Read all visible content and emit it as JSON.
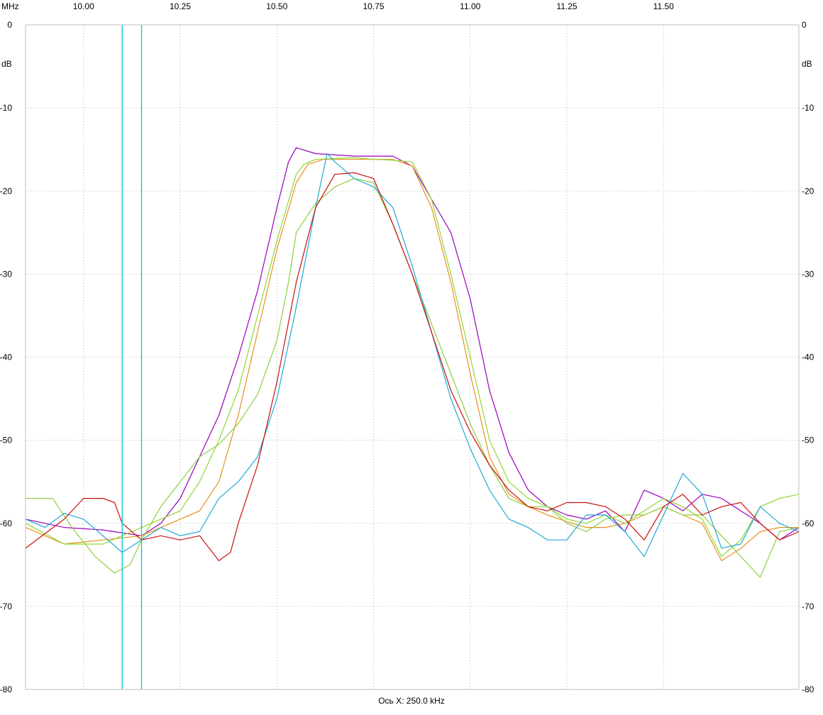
{
  "chart_data": {
    "type": "line",
    "x_unit_label": "MHz",
    "y_unit_label": "dB",
    "footer_label": "Ось X: 250.0 kHz",
    "xlim": [
      9.85,
      11.85
    ],
    "ylim": [
      -80,
      0
    ],
    "x_ticks": [
      10.0,
      10.25,
      10.5,
      10.75,
      11.0,
      11.25,
      11.5
    ],
    "x_tick_labels": [
      "10.00",
      "10.25",
      "10.50",
      "10.75",
      "11.00",
      "11.25",
      "11.50"
    ],
    "y_ticks": [
      0,
      -10,
      -20,
      -30,
      -40,
      -50,
      -60,
      -70,
      -80
    ],
    "y_tick_labels": [
      "0",
      "-10",
      "-20",
      "-30",
      "-40",
      "-50",
      "-60",
      "-70",
      "-80"
    ],
    "grid": true,
    "markers": [
      10.1,
      10.15
    ],
    "colors": {
      "marker": "#00c8c8",
      "grid": "#b4b4b4"
    },
    "series": [
      {
        "color": "#9900bb",
        "x": [
          9.85,
          9.95,
          10.05,
          10.15,
          10.2,
          10.25,
          10.3,
          10.35,
          10.4,
          10.45,
          10.5,
          10.53,
          10.55,
          10.6,
          10.7,
          10.8,
          10.85,
          10.9,
          10.95,
          11.0,
          11.05,
          11.1,
          11.15,
          11.2,
          11.25,
          11.3,
          11.35,
          11.4,
          11.45,
          11.5,
          11.55,
          11.6,
          11.65,
          11.7,
          11.75,
          11.8,
          11.85
        ],
        "y": [
          -59.5,
          -60.5,
          -60.8,
          -61.5,
          -60,
          -57,
          -52,
          -47,
          -40,
          -32,
          -22,
          -16.5,
          -14.8,
          -15.5,
          -15.8,
          -15.8,
          -17,
          -21,
          -25,
          -33,
          -44,
          -51.5,
          -56,
          -58,
          -59,
          -59.5,
          -58.5,
          -61,
          -56,
          -57,
          -58.5,
          -56.5,
          -57,
          -58.5,
          -60,
          -62,
          -60.5
        ]
      },
      {
        "color": "#e89020",
        "x": [
          9.85,
          9.95,
          10.05,
          10.15,
          10.25,
          10.3,
          10.35,
          10.4,
          10.45,
          10.5,
          10.55,
          10.58,
          10.62,
          10.7,
          10.8,
          10.85,
          10.9,
          10.95,
          11.0,
          11.05,
          11.1,
          11.15,
          11.2,
          11.25,
          11.3,
          11.35,
          11.4,
          11.45,
          11.5,
          11.55,
          11.6,
          11.65,
          11.7,
          11.75,
          11.8,
          11.85
        ],
        "y": [
          -60.5,
          -62.5,
          -62,
          -61.5,
          -59.5,
          -58.5,
          -55,
          -47,
          -37,
          -27,
          -19,
          -16.8,
          -16.2,
          -16.2,
          -16.2,
          -17,
          -22,
          -31,
          -42,
          -52,
          -56.5,
          -58,
          -59,
          -59.8,
          -60.5,
          -60.5,
          -60,
          -59,
          -58,
          -59,
          -60,
          -64.5,
          -63,
          -61,
          -60.5,
          -60.5
        ]
      },
      {
        "color": "#90d830",
        "x": [
          9.85,
          9.95,
          10.05,
          10.15,
          10.25,
          10.3,
          10.35,
          10.4,
          10.45,
          10.5,
          10.55,
          10.57,
          10.6,
          10.7,
          10.75,
          10.8,
          10.85,
          10.9,
          10.95,
          11.0,
          11.05,
          11.1,
          11.15,
          11.2,
          11.25,
          11.3,
          11.35,
          11.4,
          11.45,
          11.5,
          11.55,
          11.6,
          11.65,
          11.7,
          11.75,
          11.8,
          11.85
        ],
        "y": [
          -60,
          -62.5,
          -62.5,
          -60.5,
          -58.5,
          -55,
          -50,
          -44,
          -35,
          -26,
          -18,
          -16.8,
          -16.2,
          -16,
          -16.2,
          -16.3,
          -16.5,
          -21,
          -30,
          -40,
          -50,
          -55,
          -57,
          -58,
          -59.5,
          -60,
          -59,
          -60,
          -58.5,
          -57,
          -58,
          -59.5,
          -64,
          -62,
          -58,
          -57,
          -56.5
        ]
      },
      {
        "color": "#8cd03c",
        "x": [
          9.85,
          9.92,
          9.97,
          10.03,
          10.08,
          10.12,
          10.15,
          10.2,
          10.25,
          10.3,
          10.35,
          10.4,
          10.45,
          10.5,
          10.53,
          10.55,
          10.6,
          10.65,
          10.7,
          10.75,
          10.8,
          10.85,
          10.9,
          10.95,
          11.0,
          11.05,
          11.1,
          11.15,
          11.2,
          11.25,
          11.3,
          11.35,
          11.4,
          11.45,
          11.5,
          11.55,
          11.6,
          11.65,
          11.7,
          11.75,
          11.8,
          11.85
        ],
        "y": [
          -57,
          -57,
          -60.5,
          -64,
          -66,
          -65,
          -62,
          -58,
          -55,
          -52,
          -50.5,
          -48,
          -44.5,
          -38,
          -31,
          -25,
          -21.5,
          -19.5,
          -18.5,
          -19,
          -24,
          -30,
          -36,
          -42,
          -48,
          -53,
          -57,
          -58,
          -58,
          -60,
          -61,
          -59.5,
          -59,
          -59,
          -58,
          -59,
          -59,
          -61.5,
          -64,
          -66.5,
          -61,
          -60.5
        ]
      },
      {
        "color": "#20a8d8",
        "x": [
          9.85,
          9.9,
          9.95,
          10.0,
          10.05,
          10.1,
          10.15,
          10.2,
          10.25,
          10.3,
          10.35,
          10.4,
          10.45,
          10.5,
          10.55,
          10.6,
          10.63,
          10.65,
          10.7,
          10.75,
          10.8,
          10.85,
          10.9,
          10.95,
          11.0,
          11.05,
          11.1,
          11.15,
          11.2,
          11.25,
          11.3,
          11.35,
          11.4,
          11.45,
          11.5,
          11.55,
          11.6,
          11.65,
          11.7,
          11.75,
          11.8,
          11.85
        ],
        "y": [
          -59.5,
          -60.5,
          -58.8,
          -59.5,
          -61.5,
          -63.5,
          -62,
          -60.5,
          -61.5,
          -61,
          -57,
          -55,
          -52,
          -45,
          -34,
          -22,
          -15.5,
          -16.5,
          -18.5,
          -19.5,
          -22,
          -29,
          -37,
          -45,
          -51,
          -56,
          -59.5,
          -60.5,
          -62,
          -62,
          -59,
          -59,
          -61,
          -64,
          -59,
          -54,
          -56.5,
          -63,
          -62.5,
          -58,
          -60,
          -61
        ]
      },
      {
        "color": "#c81010",
        "x": [
          9.85,
          9.95,
          10.0,
          10.05,
          10.08,
          10.1,
          10.15,
          10.2,
          10.25,
          10.3,
          10.35,
          10.38,
          10.4,
          10.45,
          10.5,
          10.55,
          10.6,
          10.65,
          10.7,
          10.75,
          10.8,
          10.85,
          10.9,
          10.95,
          11.0,
          11.05,
          11.1,
          11.15,
          11.2,
          11.25,
          11.3,
          11.35,
          11.4,
          11.45,
          11.5,
          11.55,
          11.6,
          11.65,
          11.7,
          11.75,
          11.8,
          11.85
        ],
        "y": [
          -63,
          -59.5,
          -57,
          -57,
          -57.5,
          -60,
          -62,
          -61.5,
          -62,
          -61.5,
          -64.5,
          -63.5,
          -60,
          -53,
          -43,
          -31,
          -22,
          -18,
          -17.8,
          -18.5,
          -24,
          -30,
          -37,
          -44,
          -49,
          -53,
          -56,
          -58,
          -58.5,
          -57.5,
          -57.5,
          -58,
          -59.5,
          -62,
          -58,
          -56.5,
          -59,
          -58,
          -57.5,
          -60,
          -62,
          -61
        ]
      }
    ]
  }
}
